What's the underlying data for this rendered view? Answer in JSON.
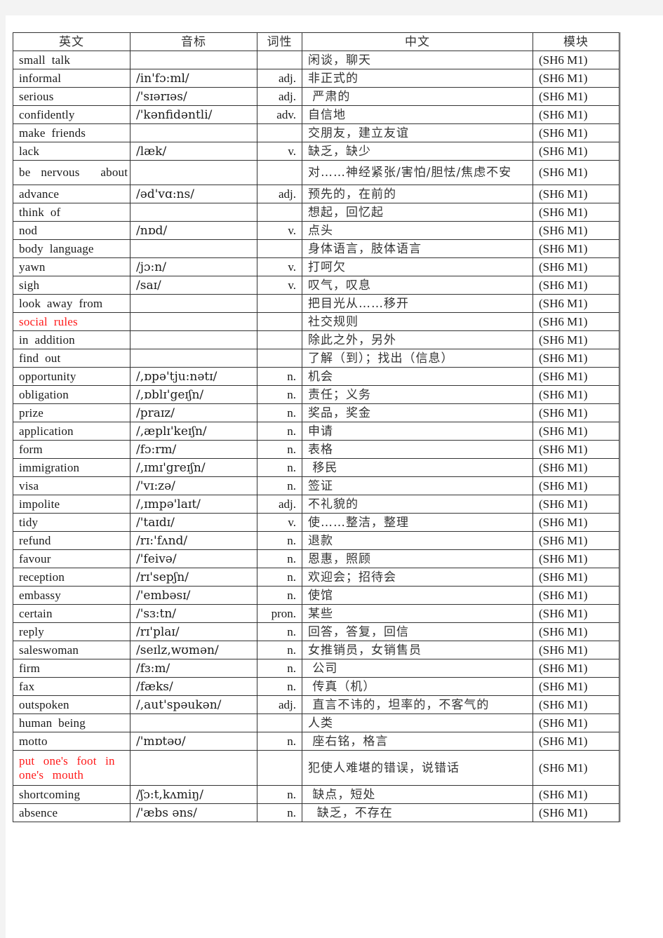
{
  "headers": {
    "english": "英文",
    "phonetic": "音标",
    "pos": "词性",
    "chinese": "中文",
    "module": "模块"
  },
  "rows": [
    {
      "en": "small  talk",
      "ph": "",
      "pos": "",
      "zh": "闲谈，聊天",
      "mod": "(SH6  M1)",
      "red": false
    },
    {
      "en": "informal",
      "ph": "/in'fɔ:ml/",
      "pos": "adj.",
      "zh": "非正式的",
      "mod": "(SH6  M1)",
      "red": false
    },
    {
      "en": "serious",
      "ph": "/'sɪərɪəs/",
      "pos": "adj.",
      "zh": " 严肃的",
      "mod": "(SH6  M1)",
      "red": false
    },
    {
      "en": "confidently",
      "ph": "/'kənfidəntli/",
      "pos": "adv.",
      "zh": "自信地",
      "mod": "(SH6  M1)",
      "red": false
    },
    {
      "en": "make  friends",
      "ph": "",
      "pos": "",
      "zh": "交朋友，建立友谊",
      "mod": "(SH6  M1)",
      "red": false
    },
    {
      "en": "lack",
      "ph": "/læk/",
      "pos": "v.",
      "zh": "缺乏，缺少",
      "mod": "(SH6  M1)",
      "red": false
    },
    {
      "en": "be  nervous    about",
      "ph": "",
      "pos": "",
      "zh": "对……神经紧张/害怕/胆怯/焦虑不安",
      "mod": "(SH6  M1)",
      "red": false
    },
    {
      "en": "advance",
      "ph": "/əd'vɑ:ns/",
      "pos": "adj.",
      "zh": "预先的，在前的",
      "mod": "(SH6  M1)",
      "red": false
    },
    {
      "en": "think  of",
      "ph": "",
      "pos": "",
      "zh": "想起，回忆起",
      "mod": "(SH6  M1)",
      "red": false
    },
    {
      "en": "nod",
      "ph": "/nɒd/",
      "pos": "v.",
      "zh": "点头",
      "mod": "(SH6  M1)",
      "red": false
    },
    {
      "en": "body  language",
      "ph": "",
      "pos": "",
      "zh": "身体语言，肢体语言",
      "mod": "(SH6  M1)",
      "red": false
    },
    {
      "en": "yawn",
      "ph": "/jɔ:n/",
      "pos": "v.",
      "zh": "打呵欠",
      "mod": "(SH6  M1)",
      "red": false
    },
    {
      "en": "sigh",
      "ph": "/saɪ/",
      "pos": "v.",
      "zh": "叹气，叹息",
      "mod": "(SH6  M1)",
      "red": false
    },
    {
      "en": "look  away  from",
      "ph": "",
      "pos": "",
      "zh": "把目光从……移开",
      "mod": "(SH6  M1)",
      "red": false
    },
    {
      "en": "social  rules",
      "ph": "",
      "pos": "",
      "zh": "社交规则",
      "mod": "(SH6  M1)",
      "red": true
    },
    {
      "en": "in  addition",
      "ph": "",
      "pos": "",
      "zh": "除此之外，另外",
      "mod": "(SH6  M1)",
      "red": false
    },
    {
      "en": "find  out",
      "ph": "",
      "pos": "",
      "zh": "了解（到）；找出（信息）",
      "mod": "(SH6  M1)",
      "red": false
    },
    {
      "en": "opportunity",
      "ph": "/,ɒpə'tju:nətɪ/",
      "pos": "n.",
      "zh": "机会",
      "mod": "(SH6  M1)",
      "red": false
    },
    {
      "en": "obligation",
      "ph": "/,ɒblɪ'geɪʃn/",
      "pos": "n.",
      "zh": "责任；义务",
      "mod": "(SH6  M1)",
      "red": false
    },
    {
      "en": "prize",
      "ph": "/praɪz/",
      "pos": "n.",
      "zh": "奖品，奖金",
      "mod": "(SH6  M1)",
      "red": false
    },
    {
      "en": "application",
      "ph": "/,æplɪ'keɪʃn/",
      "pos": "n.",
      "zh": "申请",
      "mod": "(SH6  M1)",
      "red": false
    },
    {
      "en": "form",
      "ph": "/fɔ:rm/",
      "pos": "n.",
      "zh": "表格",
      "mod": "(SH6  M1)",
      "red": false
    },
    {
      "en": "immigration",
      "ph": "/,ɪmɪ'greɪʃn/",
      "pos": "n.",
      "zh": " 移民",
      "mod": "(SH6  M1)",
      "red": false
    },
    {
      "en": "visa",
      "ph": "/'vɪ:zə/",
      "pos": "n.",
      "zh": "签证",
      "mod": "(SH6  M1)",
      "red": false
    },
    {
      "en": "impolite",
      "ph": "/,ɪmpə'laɪt/",
      "pos": "adj.",
      "zh": "不礼貌的",
      "mod": "(SH6  M1)",
      "red": false
    },
    {
      "en": "tidy",
      "ph": "/'taɪdɪ/",
      "pos": "v.",
      "zh": "使……整洁，整理",
      "mod": "(SH6  M1)",
      "red": false
    },
    {
      "en": "refund",
      "ph": "/rɪ:'fʌnd/",
      "pos": "n.",
      "zh": "退款",
      "mod": "(SH6  M1)",
      "red": false
    },
    {
      "en": "favour",
      "ph": "/'feivə/",
      "pos": "n.",
      "zh": "恩惠，照顾",
      "mod": "(SH6  M1)",
      "red": false
    },
    {
      "en": "reception",
      "ph": "/rɪ'sepʃn/",
      "pos": "n.",
      "zh": "欢迎会；招待会",
      "mod": "(SH6  M1)",
      "red": false
    },
    {
      "en": "embassy",
      "ph": "/'embəsɪ/",
      "pos": "n.",
      "zh": "使馆",
      "mod": "(SH6  M1)",
      "red": false
    },
    {
      "en": "certain",
      "ph": "/'sɜ:tn/",
      "pos": "pron.",
      "zh": "某些",
      "mod": "(SH6  M1)",
      "red": false
    },
    {
      "en": "reply",
      "ph": "/rɪ'plaɪ/",
      "pos": "n.",
      "zh": "回答，答复，回信",
      "mod": "(SH6  M1)",
      "red": false
    },
    {
      "en": "saleswoman",
      "ph": "/seɪlz,wʊmən/",
      "pos": "n.",
      "zh": "女推销员，女销售员",
      "mod": "(SH6  M1)",
      "red": false
    },
    {
      "en": "firm",
      "ph": "/fɜ:m/",
      "pos": "n.",
      "zh": " 公司",
      "mod": "(SH6  M1)",
      "red": false
    },
    {
      "en": "fax",
      "ph": "/fæks/",
      "pos": "n.",
      "zh": " 传真（机）",
      "mod": "(SH6  M1)",
      "red": false
    },
    {
      "en": "outspoken",
      "ph": "/,aut'spəukən/",
      "pos": "adj.",
      "zh": " 直言不讳的，坦率的，不客气的",
      "mod": "(SH6  M1)",
      "red": false
    },
    {
      "en": "human  being",
      "ph": "",
      "pos": "",
      "zh": "人类",
      "mod": "(SH6  M1)",
      "red": false
    },
    {
      "en": "motto",
      "ph": "/'mɒtəʊ/",
      "pos": "n.",
      "zh": " 座右铭，格言",
      "mod": "(SH6  M1)",
      "red": false
    },
    {
      "en": "put  one's  foot  in one's  mouth",
      "ph": "",
      "pos": "",
      "zh": "犯使人难堪的错误，说错话",
      "mod": "(SH6  M1)",
      "red": true
    },
    {
      "en": "shortcoming",
      "ph": "/ʃɔ:t,kʌmiŋ/",
      "pos": "n.",
      "zh": " 缺点，短处",
      "mod": "(SH6  M1)",
      "red": false
    },
    {
      "en": "absence",
      "ph": "/'æbs əns/",
      "pos": "n.",
      "zh": "  缺乏，不存在",
      "mod": "(SH6  M1)",
      "red": false
    }
  ]
}
